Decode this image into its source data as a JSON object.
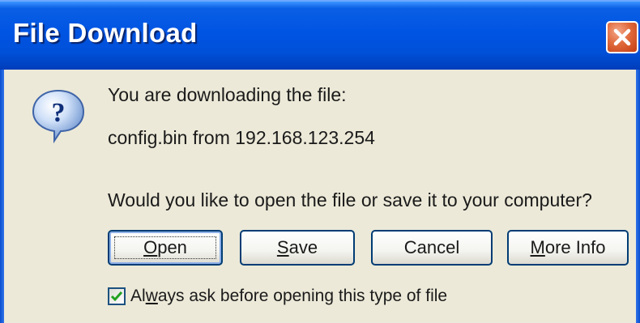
{
  "window": {
    "title": "File Download"
  },
  "message": {
    "line1": "You are downloading the file:",
    "line2": "config.bin from 192.168.123.254",
    "question": "Would you like to open the file or save it to your computer?"
  },
  "buttons": {
    "open": {
      "mnemonic": "O",
      "rest": "pen"
    },
    "save": {
      "mnemonic": "S",
      "rest": "ave"
    },
    "cancel": {
      "label": "Cancel"
    },
    "more_info": {
      "mnemonic": "M",
      "rest": "ore Info"
    }
  },
  "checkbox": {
    "checked": true,
    "label_pre": "Al",
    "label_mnemonic": "w",
    "label_post": "ays ask before opening this type of file"
  },
  "icons": {
    "question": "question-balloon-icon",
    "close": "close-x-icon",
    "check": "checkmark-icon"
  },
  "colors": {
    "titlebar": "#0054e3",
    "dialog_bg": "#ece9d8",
    "close_button": "#e06a3c"
  }
}
